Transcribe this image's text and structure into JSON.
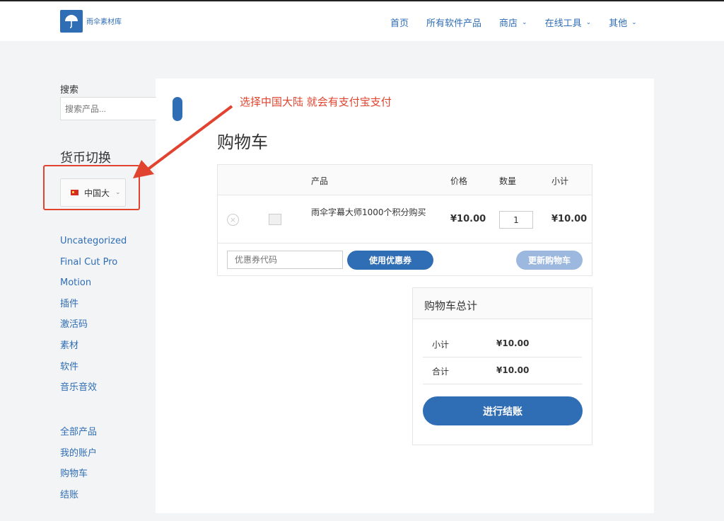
{
  "site": {
    "logo_text": "雨伞素材库"
  },
  "nav": {
    "items": [
      {
        "label": "首页",
        "has_dropdown": false
      },
      {
        "label": "所有软件产品",
        "has_dropdown": false
      },
      {
        "label": "商店",
        "has_dropdown": true
      },
      {
        "label": "在线工具",
        "has_dropdown": true
      },
      {
        "label": "其他",
        "has_dropdown": true
      }
    ]
  },
  "sidebar": {
    "search_label": "搜索",
    "search_placeholder": "搜索产品...",
    "currency_title": "货币切换",
    "currency_selected": "中国大",
    "categories": [
      "Uncategorized",
      "Final Cut Pro",
      "Motion",
      "插件",
      "激活码",
      "素材",
      "软件",
      "音乐音效"
    ],
    "account_links": [
      "全部产品",
      "我的账户",
      "购物车",
      "结账"
    ]
  },
  "annotation": {
    "text": "选择中国大陆 就会有支付宝支付",
    "color": "#e0442f"
  },
  "cart": {
    "title": "购物车",
    "headers": {
      "product": "产品",
      "price": "价格",
      "quantity": "数量",
      "subtotal": "小计"
    },
    "item": {
      "name": "雨伞字幕大师1000个积分购买",
      "price": "¥10.00",
      "quantity": "1",
      "subtotal": "¥10.00"
    },
    "coupon_placeholder": "优惠券代码",
    "apply_coupon": "使用优惠券",
    "update_cart": "更新购物车"
  },
  "totals": {
    "title": "购物车总计",
    "subtotal_label": "小计",
    "subtotal_value": "¥10.00",
    "total_label": "合计",
    "total_value": "¥10.00",
    "checkout": "进行结账"
  },
  "colors": {
    "accent": "#2f6db5",
    "annotation": "#e0442f"
  }
}
